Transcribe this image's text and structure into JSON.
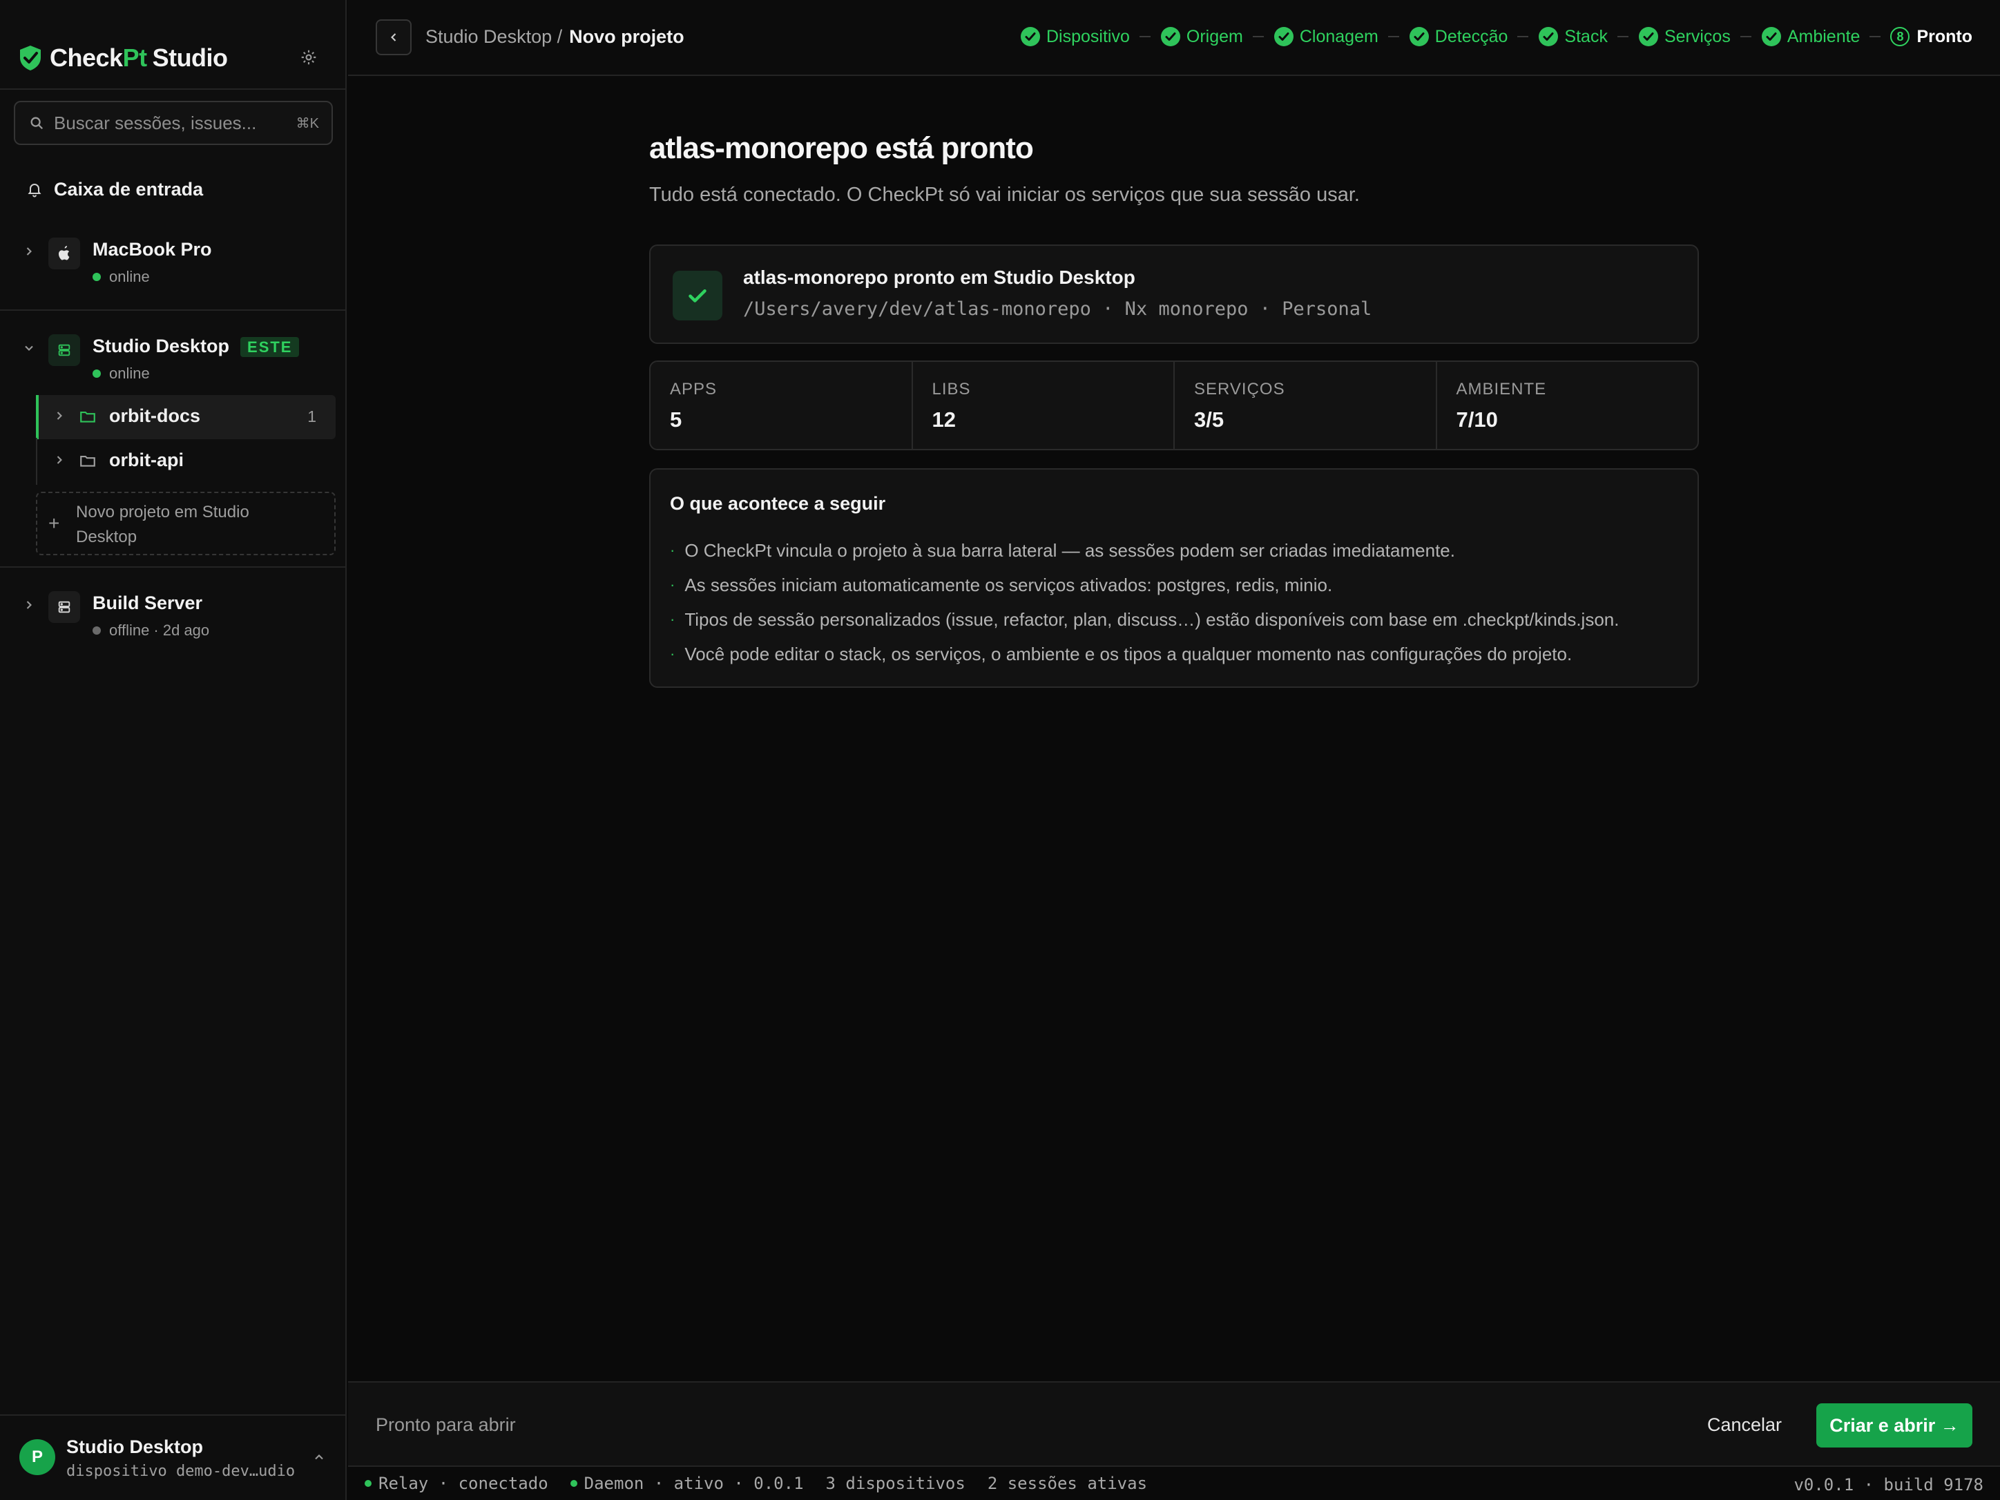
{
  "app": {
    "brand_check": "Check",
    "brand_pt": "Pt",
    "brand_studio": "Studio"
  },
  "colors": {
    "accent": "#2fc35a",
    "primary_button": "#16a34a",
    "background": "#0a0a0a"
  },
  "sidebar": {
    "search": {
      "placeholder": "Buscar sessões, issues...",
      "shortcut": "⌘K",
      "icon": "search-icon"
    },
    "inbox_label": "Caixa de entrada",
    "devices": [
      {
        "name": "MacBook Pro",
        "status": "online",
        "icon": "apple-icon",
        "expanded": false
      },
      {
        "name": "Studio Desktop",
        "status": "online",
        "badge": "ESTE",
        "icon": "server-icon",
        "expanded": true,
        "projects": [
          {
            "name": "orbit-docs",
            "count": "1",
            "active": true
          },
          {
            "name": "orbit-api",
            "active": false
          }
        ],
        "new_project_label": "Novo projeto em Studio Desktop"
      },
      {
        "name": "Build Server",
        "status": "offline · 2d ago",
        "icon": "server-icon",
        "expanded": false
      }
    ],
    "user": {
      "avatar": "P",
      "name": "Studio Desktop",
      "sub": "dispositivo demo-dev…udio"
    }
  },
  "header": {
    "breadcrumb_parent": "Studio Desktop /",
    "breadcrumb_current": "Novo projeto",
    "steps": [
      {
        "label": "Dispositivo",
        "state": "done"
      },
      {
        "label": "Origem",
        "state": "done"
      },
      {
        "label": "Clonagem",
        "state": "done"
      },
      {
        "label": "Detecção",
        "state": "done"
      },
      {
        "label": "Stack",
        "state": "done"
      },
      {
        "label": "Serviços",
        "state": "done"
      },
      {
        "label": "Ambiente",
        "state": "done"
      },
      {
        "label": "Pronto",
        "state": "current",
        "number": "8"
      }
    ]
  },
  "main": {
    "title": "atlas-monorepo está pronto",
    "subtitle": "Tudo está conectado. O CheckPt só vai iniciar os serviços que sua sessão usar.",
    "ready_card": {
      "title": "atlas-monorepo pronto em Studio Desktop",
      "meta": "/Users/avery/dev/atlas-monorepo · Nx monorepo · Personal"
    },
    "stats": [
      {
        "label": "APPS",
        "value": "5"
      },
      {
        "label": "LIBS",
        "value": "12"
      },
      {
        "label": "SERVIÇOS",
        "value": "3/5"
      },
      {
        "label": "AMBIENTE",
        "value": "7/10"
      }
    ],
    "next": {
      "title": "O que acontece a seguir",
      "bullet": "·",
      "items": [
        "O CheckPt vincula o projeto à sua barra lateral — as sessões podem ser criadas imediatamente.",
        "As sessões iniciam automaticamente os serviços ativados: postgres, redis, minio.",
        "Tipos de sessão personalizados (issue, refactor, plan, discuss…) estão disponíveis com base em .checkpt/kinds.json.",
        "Você pode editar o stack, os serviços, o ambiente e os tipos a qualquer momento nas configurações do projeto."
      ]
    }
  },
  "footer": {
    "status": "Pronto para abrir",
    "cancel_label": "Cancelar",
    "primary_label": "Criar e abrir →"
  },
  "statusbar": {
    "relay": "Relay · conectado",
    "daemon": "Daemon · ativo · 0.0.1",
    "devices": "3 dispositivos",
    "sessions": "2 sessões ativas",
    "version": "v0.0.1 · build 9178"
  }
}
